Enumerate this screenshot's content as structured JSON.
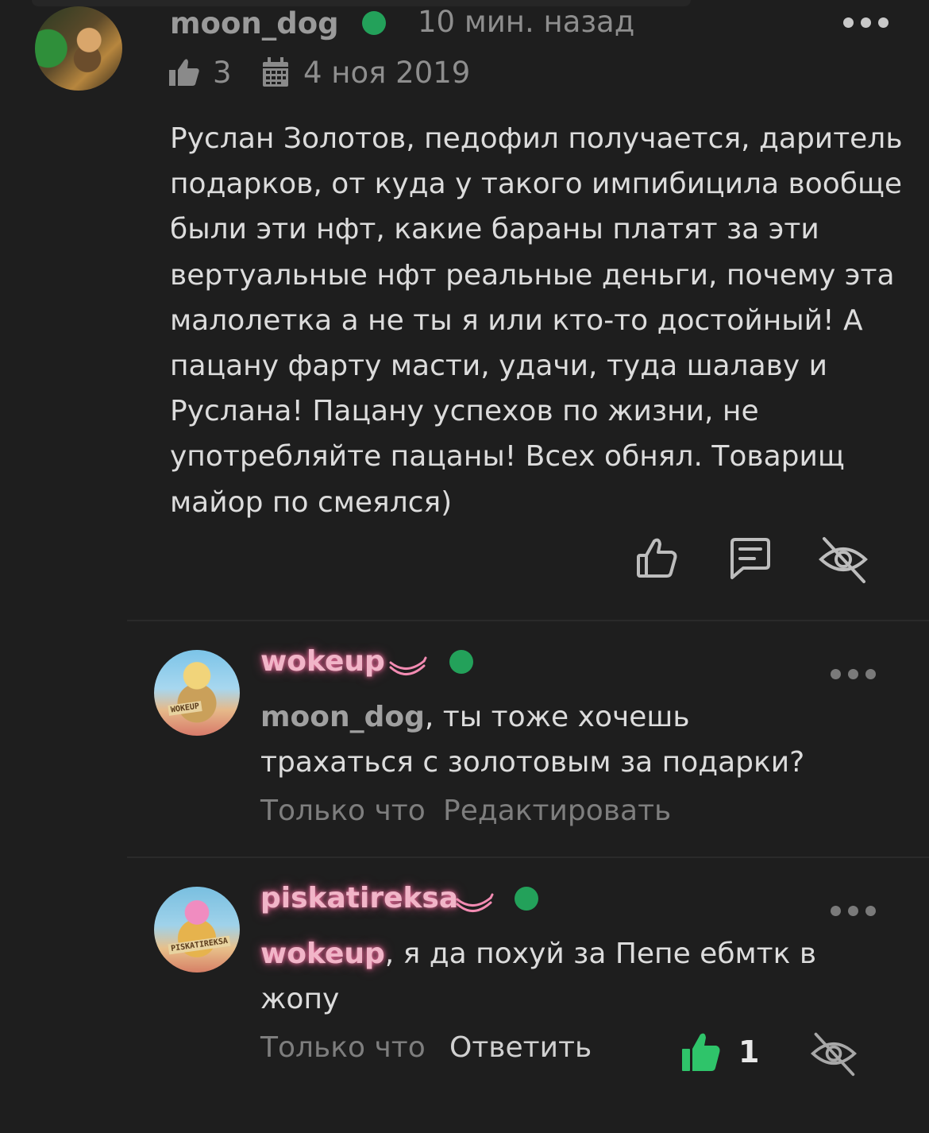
{
  "comment": {
    "username": "moon_dog",
    "time": "10 мин. назад",
    "likes": "3",
    "date": "4 ноя 2019",
    "text": "Руслан Золотов, педофил получается, даритель\nподарков, от куда у такого импибицила вообще\nбыли эти нфт, какие бараны платят за эти\nвертуальные нфт реальные деньги, почему эта\nмалолетка а не ты я или кто-то достойный! А\nпацану фарту масти, удачи, туда шалаву и\nРуслана! Пацану успехов по жизни, не\nупотребляйте пацаны! Всех обнял. Товарищ\nмайор по смеялся)"
  },
  "replies": [
    {
      "username": "wokeup",
      "mention": "moon_dog",
      "text": ", ты тоже хочешь трахаться с золотовым за подарки?",
      "time": "Только что",
      "action": "Редактировать",
      "avatar_label": "WOKEUP"
    },
    {
      "username": "piskatireksa",
      "mention": "wokeup",
      "text": ", я да похуй за Пепе ебмтк в жопу",
      "time": "Только что",
      "action": "Ответить",
      "likes": "1",
      "avatar_label": "PISKATIREKSA"
    }
  ],
  "colors": {
    "background": "#1e1e1e",
    "online": "#23a15a",
    "liked": "#2fc46a",
    "pink_glow": "#f1b5c8"
  },
  "icons": [
    "thumbs-up-icon",
    "calendar-icon",
    "comment-icon",
    "hide-eye-icon",
    "banana-icon",
    "more-icon"
  ]
}
